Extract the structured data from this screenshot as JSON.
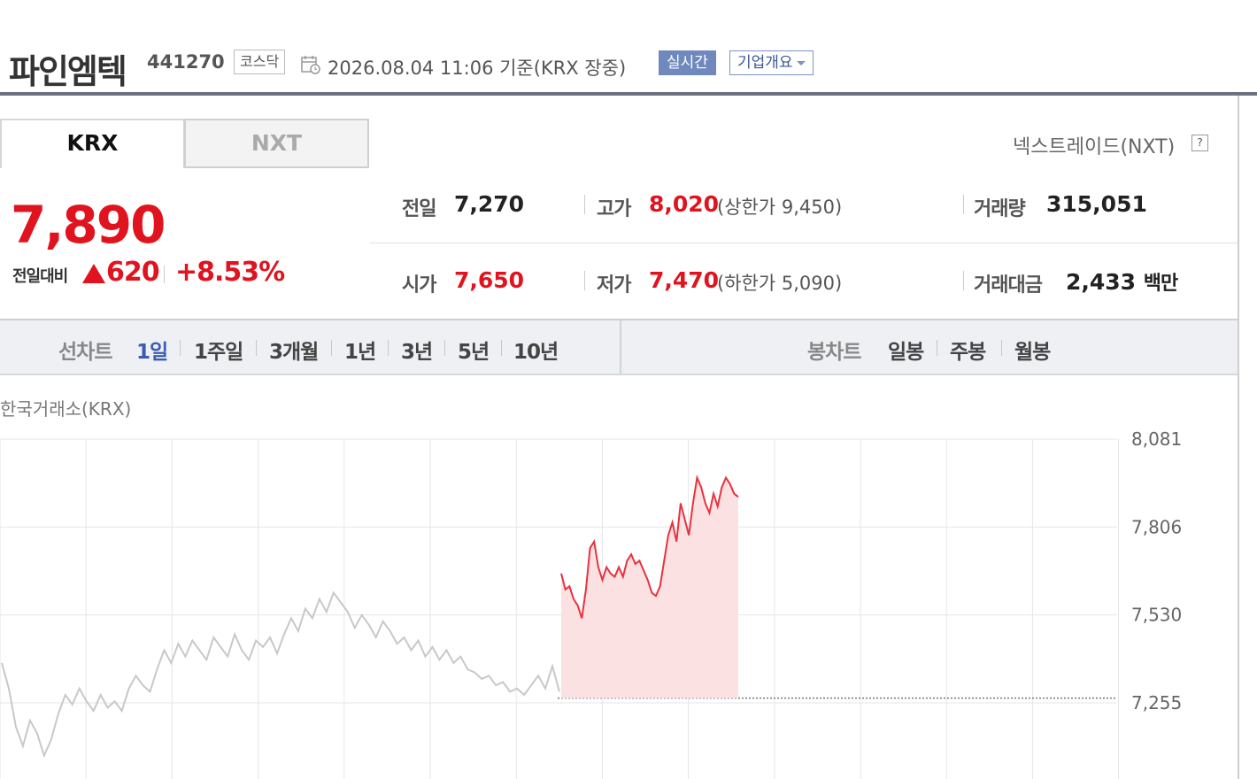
{
  "header": {
    "company_name": "파인엠텍",
    "stock_code": "441270",
    "market": "코스닥",
    "datetime": "2026.08.04 11:06  기준(KRX 장중)",
    "realtime_label": "실시간",
    "company_info_label": "기업개요"
  },
  "tabs": [
    {
      "label": "KRX",
      "active": true
    },
    {
      "label": "NXT",
      "active": false
    }
  ],
  "nxt_link": "넥스트레이드(NXT)",
  "price": {
    "current": "7,890",
    "change_label": "전일대비",
    "change": "620",
    "change_pct": "+8.53%",
    "up_color": "#e0131e"
  },
  "stats": {
    "prev_close": {
      "label": "전일",
      "value": "7,270"
    },
    "high": {
      "label": "고가",
      "value": "8,020",
      "sub_label": "상한가",
      "sub_value": "9,450"
    },
    "volume": {
      "label": "거래량",
      "value": "315,051"
    },
    "open": {
      "label": "시가",
      "value": "7,650"
    },
    "low": {
      "label": "저가",
      "value": "7,470",
      "sub_label": "하한가",
      "sub_value": "5,090"
    },
    "turnover": {
      "label": "거래대금",
      "value": "2,433",
      "unit": "백만"
    }
  },
  "period": {
    "line_label": "선차트",
    "line_items": [
      "1일",
      "1주일",
      "3개월",
      "1년",
      "3년",
      "5년",
      "10년"
    ],
    "active": "1일",
    "candle_label": "봉차트",
    "candle_items": [
      "일봉",
      "주봉",
      "월봉"
    ]
  },
  "chart_data": {
    "type": "line",
    "source_label": "한국거래소(KRX)",
    "y_ticks": [
      "8,081",
      "7,806",
      "7,530",
      "7,255"
    ],
    "ylim": [
      7255,
      8081
    ],
    "reference": 7270,
    "grid": true,
    "series": [
      {
        "style": "previous-day (gray)",
        "values": [
          7380,
          7300,
          7180,
          7120,
          7200,
          7160,
          7090,
          7140,
          7220,
          7280,
          7250,
          7300,
          7260,
          7230,
          7280,
          7240,
          7260,
          7230,
          7300,
          7340,
          7310,
          7290,
          7360,
          7420,
          7380,
          7440,
          7400,
          7450,
          7420,
          7390,
          7460,
          7430,
          7400,
          7470,
          7420,
          7390,
          7450,
          7430,
          7460,
          7410,
          7470,
          7520,
          7480,
          7550,
          7520,
          7580,
          7540,
          7600,
          7570,
          7540,
          7490,
          7530,
          7500,
          7460,
          7510,
          7480,
          7440,
          7460,
          7420,
          7450,
          7400,
          7430,
          7390,
          7420,
          7380,
          7400,
          7360,
          7350,
          7330,
          7340,
          7310,
          7320,
          7290,
          7300,
          7280,
          7310,
          7340,
          7300,
          7370,
          7290
        ]
      },
      {
        "style": "today (red)",
        "values": [
          7660,
          7610,
          7620,
          7580,
          7560,
          7520,
          7610,
          7740,
          7760,
          7680,
          7640,
          7680,
          7660,
          7650,
          7680,
          7650,
          7700,
          7720,
          7690,
          7700,
          7670,
          7640,
          7600,
          7590,
          7620,
          7700,
          7780,
          7820,
          7760,
          7880,
          7830,
          7780,
          7880,
          7960,
          7930,
          7880,
          7850,
          7910,
          7870,
          7930,
          7960,
          7940,
          7910,
          7900
        ]
      }
    ]
  }
}
